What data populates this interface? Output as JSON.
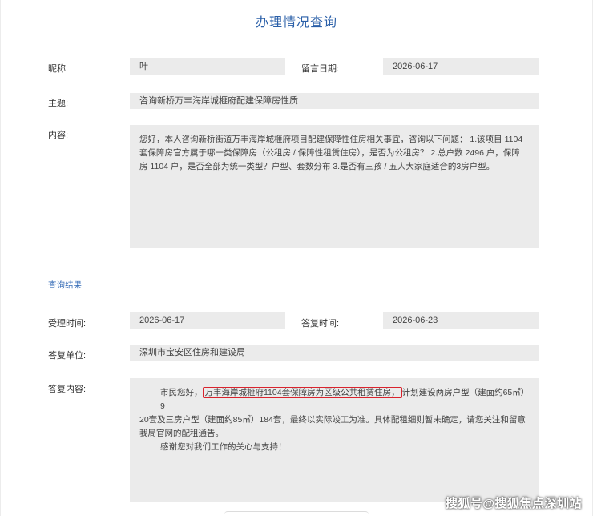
{
  "page": {
    "title": "办理情况查询"
  },
  "inquiry": {
    "nickname_label": "昵称:",
    "nickname": "叶",
    "date_label": "留言日期:",
    "date": "2026-06-17",
    "subject_label": "主题:",
    "subject": "咨询新桥万丰海岸城榧府配建保障房性质",
    "content_label": "内容:",
    "content_line1": "您好，本人咨询新桥街道万丰海岸城榧府项目配建保障性住房相关事宜，咨询以下问题： 1.该项目 1104",
    "content_line2": "套保障房官方属于哪一类保障房（公租房 / 保障性租赁住房），是否为公租房？ 2.总户数 2496 户，保障",
    "content_line3": "房 1104 户，是否全部为统一类型？户型、套数分布 3.是否有三孩 / 五人大家庭适合的3房户型。"
  },
  "result": {
    "section_title": "查询结果",
    "accept_time_label": "受理时间:",
    "accept_time": "2026-06-17",
    "reply_time_label": "答复时间:",
    "reply_time": "2026-06-23",
    "unit_label": "答复单位:",
    "unit": "深圳市宝安区住房和建设局",
    "reply_label": "答复内容:",
    "reply_prefix": "市民您好，",
    "reply_highlight": "万丰海岸城榧府1104套保障房为区级公共租赁住房，",
    "reply_after": "计划建设两房户型（建面约65㎡）9",
    "reply_line2": "20套及三房户型（建面约85㎡）184套，最终以实际竣工为准。具体配租细则暂未确定，请您关注和留意",
    "reply_line3": "我局官网的配租通告。",
    "reply_thanks": "感谢您对我们工作的关心与支持！"
  },
  "watermark": {
    "text": "搜狐号@搜狐焦点深圳站"
  },
  "colors": {
    "title": "#2a5fa8",
    "section": "#3a6fb8",
    "field_bg": "#ebebeb",
    "highlight": "#d9232d"
  }
}
